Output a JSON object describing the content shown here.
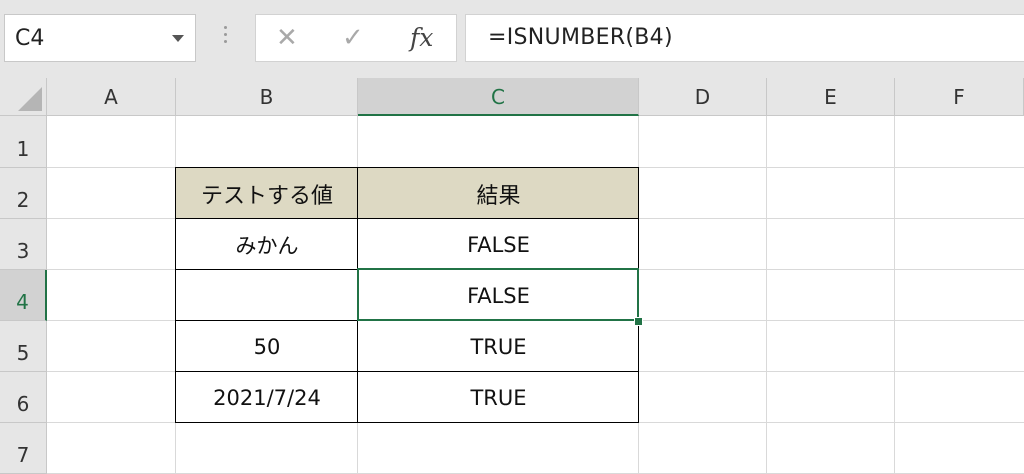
{
  "formula_bar": {
    "name_box": "C4",
    "formula": "=ISNUMBER(B4)",
    "cancel_icon": "✕",
    "enter_icon": "✓",
    "fx_icon": "fx"
  },
  "columns": [
    "A",
    "B",
    "C",
    "D",
    "E",
    "F"
  ],
  "rows": [
    "1",
    "2",
    "3",
    "4",
    "5",
    "6",
    "7"
  ],
  "active_cell": "C4",
  "table": {
    "header": {
      "b": "テストする値",
      "c": "結果"
    },
    "rows": [
      {
        "b": "みかん",
        "c": "FALSE"
      },
      {
        "b": "",
        "c": "FALSE"
      },
      {
        "b": "50",
        "c": "TRUE"
      },
      {
        "b": "2021/7/24",
        "c": "TRUE"
      }
    ]
  },
  "colors": {
    "header_fill": "#ddd9c3",
    "selection": "#217346"
  }
}
